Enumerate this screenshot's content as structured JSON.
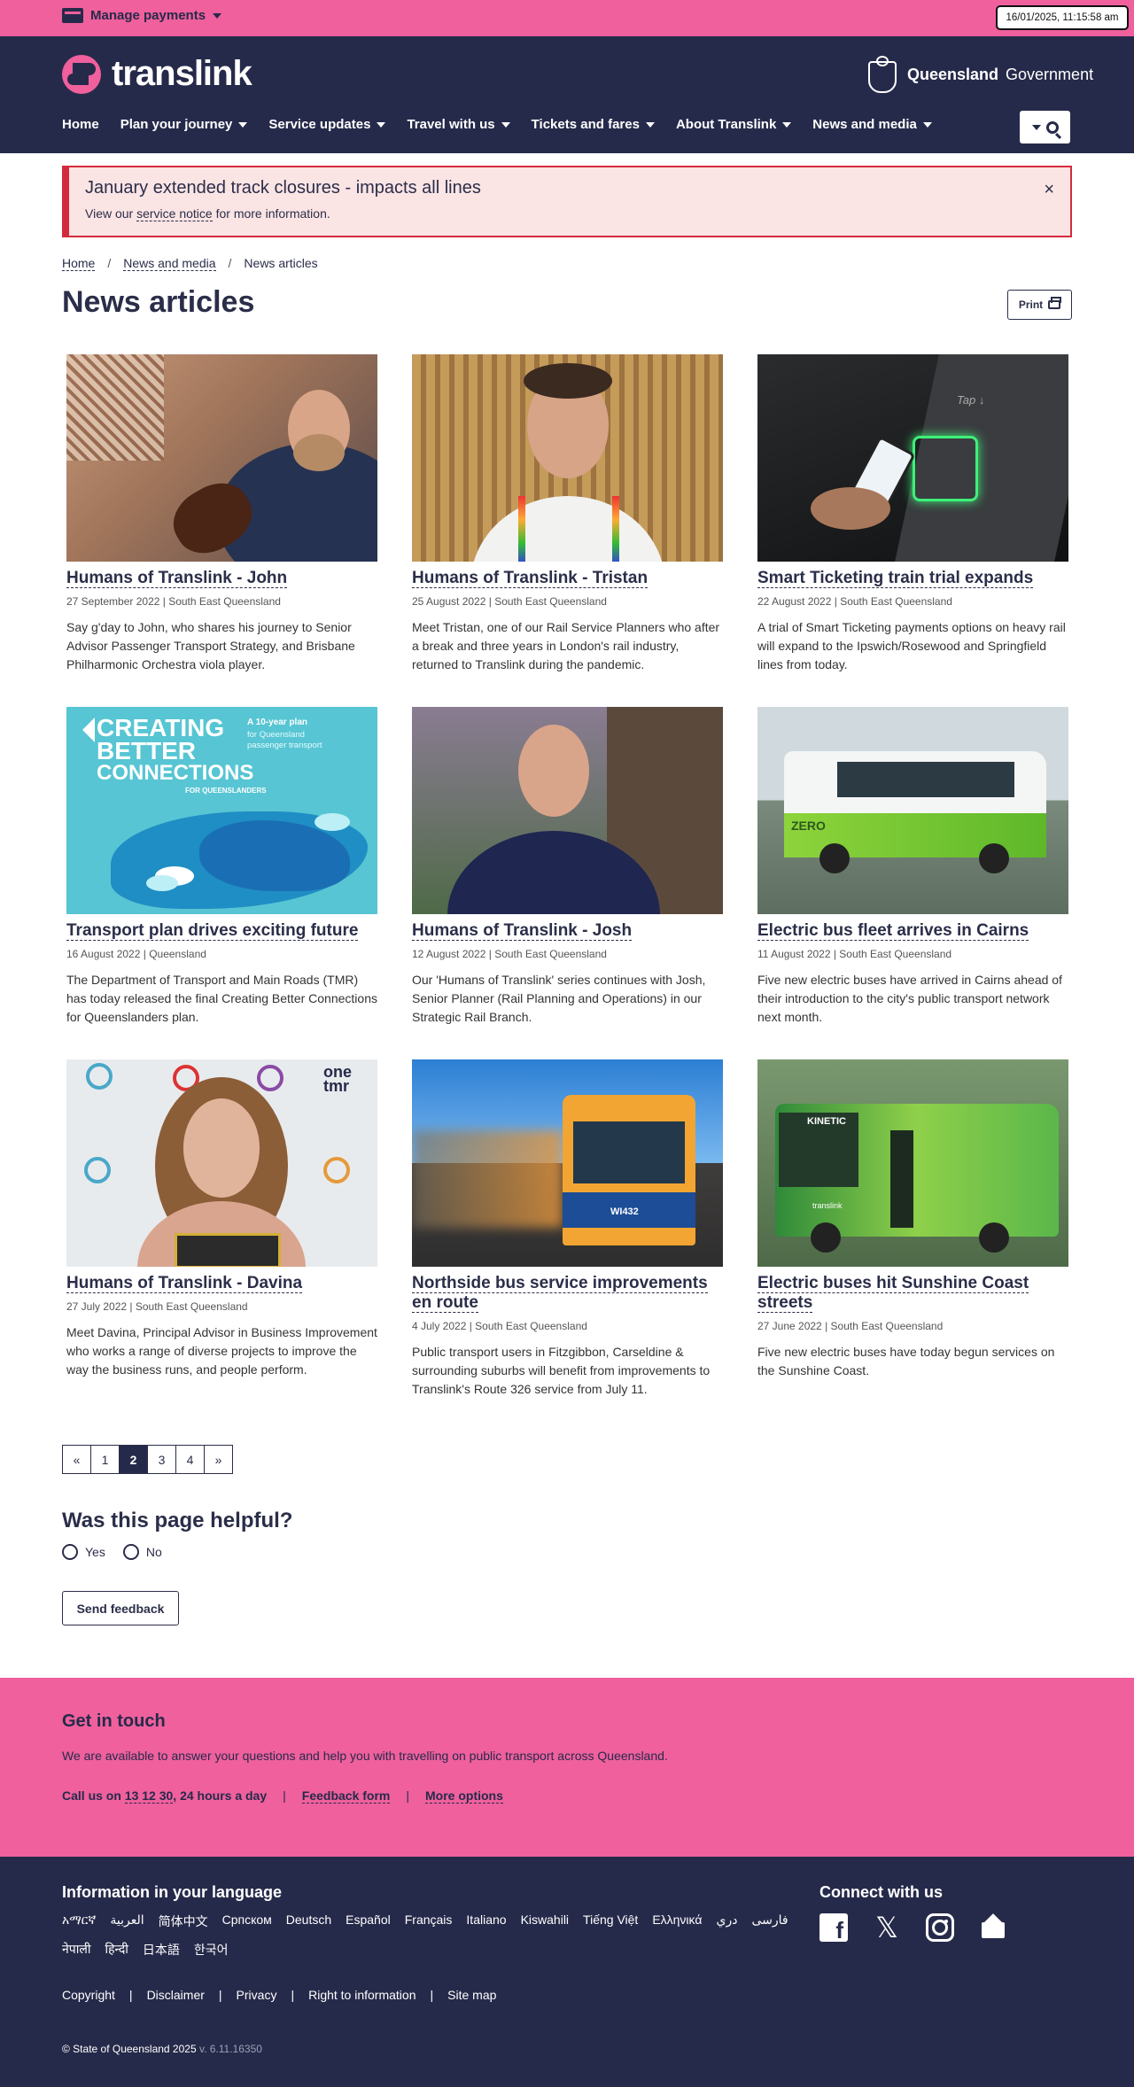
{
  "topbar": {
    "manage_payments": "Manage payments",
    "timestamp": "16/01/2025, 11:15:58 am"
  },
  "header": {
    "logo_text": "translink",
    "gov_bold": "Queensland",
    "gov_light": "Government",
    "nav": [
      "Home",
      "Plan your journey",
      "Service updates",
      "Travel with us",
      "Tickets and fares",
      "About Translink",
      "News and media"
    ]
  },
  "alert": {
    "title": "January extended track closures - impacts all lines",
    "text_before": "View our ",
    "link": "service notice",
    "text_after": " for more information.",
    "close": "×"
  },
  "breadcrumb": {
    "home": "Home",
    "sep": "/",
    "news_media": "News and media",
    "current": "News articles"
  },
  "page": {
    "title": "News articles",
    "print": "Print"
  },
  "articles": [
    {
      "title": "Humans of Translink - John",
      "meta": "27 September 2022 | South East Queensland",
      "desc": "Say g'day to John, who shares his journey to Senior Advisor Passenger Transport Strategy, and Brisbane Philharmonic Orchestra viola player."
    },
    {
      "title": "Humans of Translink - Tristan",
      "meta": "25 August 2022 | South East Queensland",
      "desc": "Meet Tristan, one of our Rail Service Planners who after a break and three years in London's rail industry, returned to Translink during the pandemic."
    },
    {
      "title": "Smart Ticketing train trial expands",
      "meta": "22 August 2022 | South East Queensland",
      "desc": "A trial of Smart Ticketing payments options on heavy rail will expand to the Ipswich/Rosewood and Springfield lines from today."
    },
    {
      "title": "Transport plan drives exciting future",
      "meta": "16 August 2022 | Queensland",
      "desc": "The Department of Transport and Main Roads (TMR) has today released the final Creating Better Connections for Queenslanders plan."
    },
    {
      "title": "Humans of Translink - Josh",
      "meta": "12 August 2022 | South East Queensland",
      "desc": "Our 'Humans of Translink' series continues with Josh, Senior Planner (Rail Planning and Operations) in our Strategic Rail Branch."
    },
    {
      "title": "Electric bus fleet arrives in Cairns",
      "meta": "11 August 2022 | South East Queensland",
      "desc": "Five new electric buses have arrived in Cairns ahead of their introduction to the city's public transport network next month."
    },
    {
      "title": "Humans of Translink - Davina",
      "meta": "27 July 2022 | South East Queensland",
      "desc": "Meet Davina, Principal Advisor in Business Improvement who works a range of diverse projects to improve the way the business runs, and people perform."
    },
    {
      "title": "Northside bus service improvements en route",
      "meta": "4 July 2022 | South East Queensland",
      "desc": "Public transport users in Fitzgibbon, Carseldine & surrounding suburbs will benefit from improvements to Translink's Route 326 service from July 11."
    },
    {
      "title": "Electric buses hit Sunshine Coast streets",
      "meta": "27 June 2022 | South East Queensland",
      "desc": "Five new electric buses have today begun services on the Sunshine Coast."
    }
  ],
  "image_text": {
    "tap": "Tap ↓",
    "plan_headline_1": "CREATING",
    "plan_headline_2": "BETTER",
    "plan_headline_3": "CONNECTIONS",
    "plan_sub": "FOR QUEENSLANDERS",
    "plan_side_bold": "A 10-year plan",
    "plan_side": "for Queensland passenger transport",
    "zero": "ZERO",
    "onetmr": "one tmr",
    "bus_number": "WI432",
    "kinetic": "KINETIC",
    "translink_small": "translink"
  },
  "pagination": [
    "«",
    "1",
    "2",
    "3",
    "4",
    "»"
  ],
  "pagination_active": "2",
  "feedback": {
    "question": "Was this page helpful?",
    "yes": "Yes",
    "no": "No",
    "send": "Send feedback"
  },
  "contact": {
    "title": "Get in touch",
    "text": "We are available to answer your questions and help you with travelling on public transport across Queensland.",
    "call_prefix": "Call us on ",
    "phone": "13 12 30",
    "call_suffix": ", 24 hours a day",
    "sep": "|",
    "feedback_form": "Feedback form",
    "more_options": "More options"
  },
  "footer": {
    "lang_title": "Information in your language",
    "languages": [
      "አማርኛ",
      "العربية",
      "简体中文",
      "Српском",
      "Deutsch",
      "Español",
      "Français",
      "Italiano",
      "Kiswahili",
      "Tiếng Việt",
      "Ελληνικά",
      "دري",
      "فارسی",
      "नेपाली",
      "हिन्दी",
      "日本語",
      "한국어"
    ],
    "connect_title": "Connect with us",
    "links": [
      "Copyright",
      "Disclaimer",
      "Privacy",
      "Right to information",
      "Site map"
    ],
    "link_sep": "|",
    "copyright": "© State of Queensland 2025",
    "version": "v. 6.11.16350"
  },
  "colors": {
    "navy": "#262a4a",
    "pink": "#ef609d",
    "alert_red": "#d42b3c",
    "alert_bg": "#fbe4e4"
  }
}
